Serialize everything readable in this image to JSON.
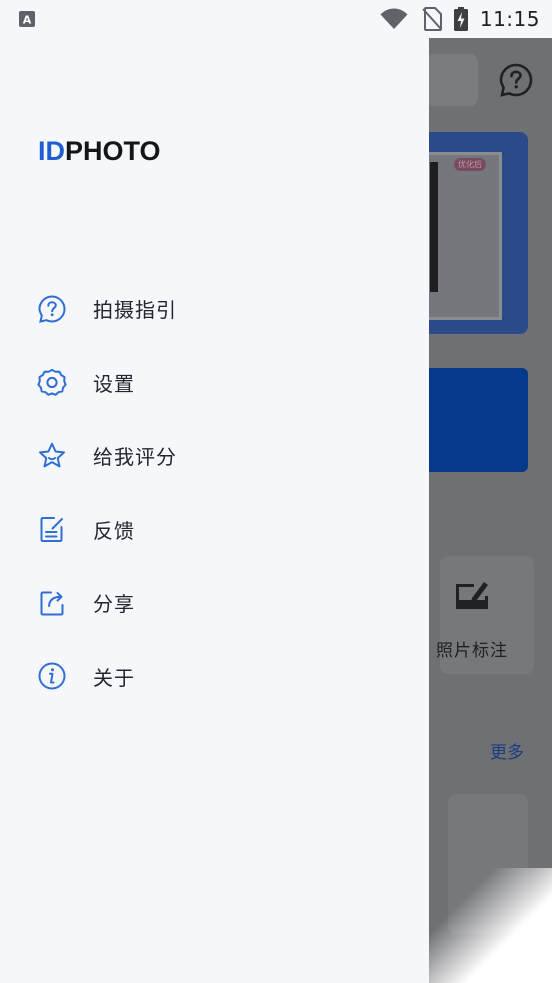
{
  "status_bar": {
    "notification_icon": "a-text-icon",
    "time": "11:15",
    "icons": [
      "wifi-icon",
      "no-sim-icon",
      "battery-charging-icon"
    ]
  },
  "drawer": {
    "logo": {
      "prefix": "ID",
      "suffix": "PHOTO"
    },
    "menu": [
      {
        "label": "拍摄指引",
        "icon": "help-bubble-icon"
      },
      {
        "label": "设置",
        "icon": "gear-icon"
      },
      {
        "label": "给我评分",
        "icon": "star-icon"
      },
      {
        "label": "反馈",
        "icon": "edit-note-icon"
      },
      {
        "label": "分享",
        "icon": "share-icon"
      },
      {
        "label": "关于",
        "icon": "info-icon"
      }
    ]
  },
  "background": {
    "tool_label": "照片标注",
    "more_link": "更多",
    "banner_badge": "优化后"
  },
  "colors": {
    "accent": "#1d5fd1",
    "drawer_bg": "#f5f7fa",
    "scrim": "#6f7073",
    "icon_blue": "#2f6fd3"
  }
}
